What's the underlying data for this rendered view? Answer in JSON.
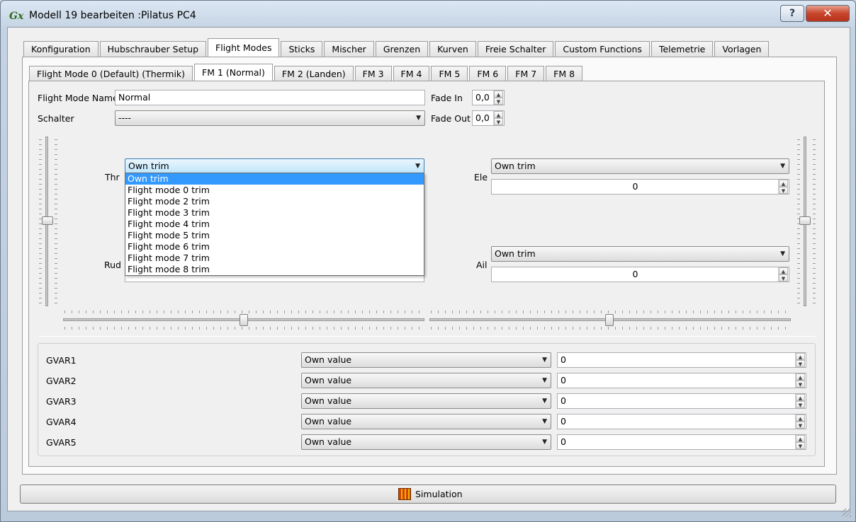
{
  "window": {
    "title": "Modell 19 bearbeiten :Pilatus PC4",
    "help_label": "?",
    "close_label": "✕"
  },
  "main_tabs": [
    "Konfiguration",
    "Hubschrauber Setup",
    "Flight Modes",
    "Sticks",
    "Mischer",
    "Grenzen",
    "Kurven",
    "Freie Schalter",
    "Custom Functions",
    "Telemetrie",
    "Vorlagen"
  ],
  "main_tab_active": "Flight Modes",
  "mode_tabs": [
    "Flight Mode 0 (Default) (Thermik)",
    "FM 1 (Normal)",
    "FM 2 (Landen)",
    "FM 3",
    "FM 4",
    "FM 5",
    "FM 6",
    "FM 7",
    "FM 8"
  ],
  "mode_tab_active": "FM 1 (Normal)",
  "form": {
    "name_label": "Flight Mode Name",
    "name_value": "Normal",
    "switch_label": "Schalter",
    "switch_value": "----",
    "fade_in_label": "Fade In",
    "fade_in_value": "0,0",
    "fade_out_label": "Fade Out",
    "fade_out_value": "0,0"
  },
  "trims": {
    "thr": {
      "label": "Thr",
      "mode": "Own trim"
    },
    "rud": {
      "label": "Rud"
    },
    "ele": {
      "label": "Ele",
      "mode": "Own trim",
      "value": "0"
    },
    "ail": {
      "label": "Ail",
      "mode": "Own trim",
      "value": "0"
    }
  },
  "thr_dropdown_options": [
    "Own trim",
    "Flight mode 0 trim",
    "Flight mode 2 trim",
    "Flight mode 3 trim",
    "Flight mode 4 trim",
    "Flight mode 5 trim",
    "Flight mode 6 trim",
    "Flight mode 7 trim",
    "Flight mode 8 trim"
  ],
  "gvars": [
    {
      "label": "GVAR1",
      "mode": "Own value",
      "value": "0"
    },
    {
      "label": "GVAR2",
      "mode": "Own value",
      "value": "0"
    },
    {
      "label": "GVAR3",
      "mode": "Own value",
      "value": "0"
    },
    {
      "label": "GVAR4",
      "mode": "Own value",
      "value": "0"
    },
    {
      "label": "GVAR5",
      "mode": "Own value",
      "value": "0"
    }
  ],
  "simulation_label": "Simulation",
  "colors": {
    "selection": "#3399ff",
    "close": "#c8452c"
  },
  "icons": [
    "app-logo-icon",
    "help-icon",
    "close-icon",
    "chevron-down-icon",
    "spin-up-icon",
    "spin-down-icon",
    "simulation-icon",
    "resize-grip-icon"
  ]
}
